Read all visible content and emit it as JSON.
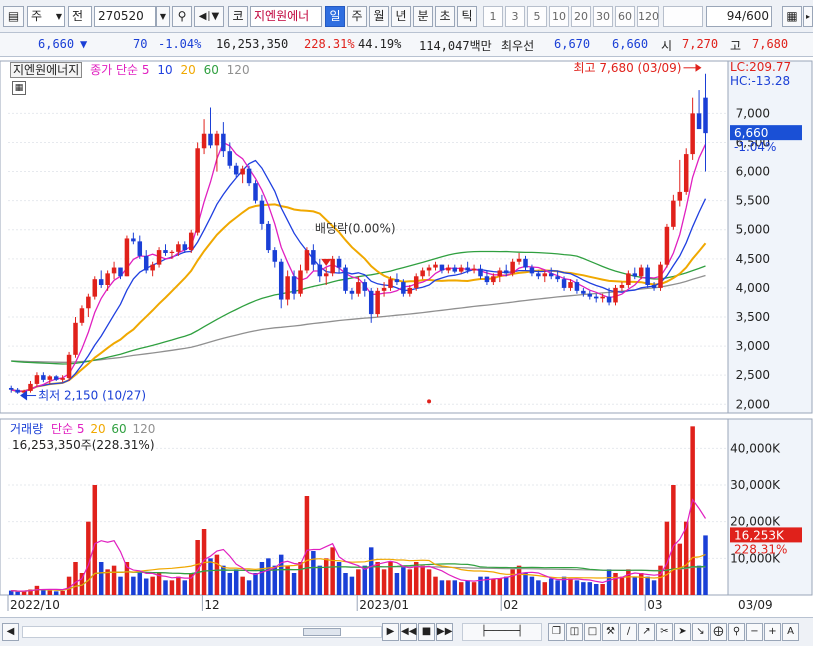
{
  "toolbar": {
    "market": "주",
    "type": "전",
    "code": "270520",
    "stock_prefix": "코",
    "stock_name": "지엔원에너",
    "periods": [
      "일",
      "주",
      "월",
      "년",
      "분",
      "초",
      "틱"
    ],
    "active_period": "일",
    "intervals": [
      "1",
      "3",
      "5",
      "10",
      "20",
      "30",
      "60",
      "120"
    ],
    "page": "94",
    "page_total": "/600"
  },
  "quote": {
    "price": "6,660",
    "change": "70",
    "change_pct": "-1.04%",
    "volume": "16,253,350",
    "volume_ratio": "228.31%",
    "turnover": "44.19%",
    "amount": "114,047백만",
    "best_ask_label": "최우선",
    "best_ask": "6,670",
    "best_bid": "6,660",
    "open_label": "시",
    "open": "7,270",
    "high_label": "고",
    "high": "7,680"
  },
  "price_panel": {
    "legend_name": "지엔원에너지",
    "legend_ma_label": "종가 단순 5",
    "legend_ma": [
      "10",
      "20",
      "60",
      "120"
    ],
    "lc_label": "LC:209.77",
    "hc_label": "HC:-13.28",
    "current_price": "6,660",
    "current_pct": "-1.04%",
    "high_annotation": "최고 7,680 (03/09)",
    "low_annotation": "최저 2,150 (10/27)",
    "event_annotation": "배당락(0.00%)"
  },
  "volume_panel": {
    "legend_name": "거래량",
    "legend_ma_label": "단순 5",
    "legend_ma": [
      "20",
      "60",
      "120"
    ],
    "volume_line": "16,253,350주(228.31%)",
    "current_volume": "16,253K",
    "current_ratio": "228.31%"
  },
  "chart_data": {
    "type": "candlestick",
    "x_ticks": [
      "2022/10",
      "12",
      "2023/01",
      "02",
      "03",
      "03/09"
    ],
    "price_axis": {
      "ticks": [
        "7,000",
        "6,500",
        "6,000",
        "5,500",
        "5,000",
        "4,500",
        "4,000",
        "3,500",
        "3,000",
        "2,500",
        "2,000"
      ],
      "range": [
        1850,
        7900
      ]
    },
    "volume_axis": {
      "ticks": [
        "40,000K",
        "30,000K",
        "20,000K",
        "10,000K"
      ],
      "range": [
        0,
        48000
      ]
    },
    "series_colors": {
      "ma5": "#e020c0",
      "ma10": "#2040e0",
      "ma20": "#f0a800",
      "ma60": "#30a040",
      "ma120": "#909090",
      "up": "#e0211b",
      "down": "#1a3fd6"
    },
    "candles": [
      [
        2280,
        2320,
        2200,
        2250,
        1200
      ],
      [
        2250,
        2280,
        2180,
        2200,
        900
      ],
      [
        2200,
        2250,
        2150,
        2230,
        1100
      ],
      [
        2230,
        2400,
        2200,
        2350,
        1500
      ],
      [
        2350,
        2550,
        2300,
        2500,
        2500
      ],
      [
        2500,
        2550,
        2380,
        2420,
        1500
      ],
      [
        2420,
        2500,
        2350,
        2480,
        1200
      ],
      [
        2480,
        2500,
        2400,
        2420,
        1000
      ],
      [
        2420,
        2500,
        2380,
        2450,
        1100
      ],
      [
        2450,
        2900,
        2400,
        2850,
        5000
      ],
      [
        2850,
        3500,
        2800,
        3400,
        9000
      ],
      [
        3400,
        3700,
        3350,
        3650,
        6000
      ],
      [
        3650,
        3900,
        3500,
        3850,
        20000
      ],
      [
        3850,
        4200,
        3800,
        4150,
        30000
      ],
      [
        4150,
        4300,
        4000,
        4050,
        9000
      ],
      [
        4050,
        4300,
        3950,
        4250,
        7000
      ],
      [
        4250,
        4450,
        4150,
        4350,
        8000
      ],
      [
        4350,
        4350,
        4150,
        4200,
        5000
      ],
      [
        4200,
        4900,
        4200,
        4850,
        9000
      ],
      [
        4850,
        4950,
        4750,
        4800,
        5000
      ],
      [
        4800,
        4900,
        4500,
        4550,
        6000
      ],
      [
        4550,
        4650,
        4250,
        4300,
        4500
      ],
      [
        4300,
        4450,
        4200,
        4400,
        5000
      ],
      [
        4400,
        4700,
        4350,
        4650,
        6000
      ],
      [
        4650,
        4750,
        4550,
        4600,
        4000
      ],
      [
        4600,
        4650,
        4500,
        4620,
        4000
      ],
      [
        4620,
        4800,
        4550,
        4750,
        5000
      ],
      [
        4750,
        4800,
        4600,
        4650,
        4000
      ],
      [
        4650,
        5000,
        4600,
        4950,
        6000
      ],
      [
        4950,
        6500,
        4900,
        6400,
        15000
      ],
      [
        6400,
        6900,
        6300,
        6650,
        18000
      ],
      [
        6650,
        7100,
        6400,
        6450,
        10000
      ],
      [
        6450,
        6700,
        6000,
        6650,
        11000
      ],
      [
        6650,
        6850,
        6250,
        6350,
        8000
      ],
      [
        6350,
        6500,
        6050,
        6100,
        6000
      ],
      [
        6100,
        6150,
        5900,
        5950,
        7000
      ],
      [
        5950,
        6100,
        5800,
        6050,
        5000
      ],
      [
        6050,
        6100,
        5750,
        5800,
        4000
      ],
      [
        5800,
        5850,
        5450,
        5500,
        6000
      ],
      [
        5500,
        5600,
        5000,
        5100,
        9000
      ],
      [
        5100,
        5150,
        4600,
        4650,
        10000
      ],
      [
        4650,
        4700,
        4350,
        4450,
        8000
      ],
      [
        4450,
        4500,
        3650,
        3800,
        11000
      ],
      [
        3800,
        4300,
        3700,
        4200,
        8000
      ],
      [
        4200,
        4300,
        3800,
        3900,
        6000
      ],
      [
        3900,
        4400,
        3850,
        4300,
        9000
      ],
      [
        4300,
        4700,
        4250,
        4650,
        27000
      ],
      [
        4650,
        4750,
        4300,
        4400,
        12000
      ],
      [
        4400,
        4500,
        4100,
        4200,
        8000
      ],
      [
        4200,
        4350,
        4050,
        4250,
        10000
      ],
      [
        4250,
        4550,
        4200,
        4500,
        13000
      ],
      [
        4500,
        4550,
        4250,
        4350,
        9000
      ],
      [
        4350,
        4400,
        3900,
        3950,
        6000
      ],
      [
        3950,
        4000,
        3800,
        3900,
        5000
      ],
      [
        3900,
        4200,
        3850,
        4100,
        7000
      ],
      [
        4100,
        4150,
        3850,
        3950,
        8000
      ],
      [
        3950,
        4000,
        3400,
        3550,
        13000
      ],
      [
        3550,
        4000,
        3500,
        3950,
        9000
      ],
      [
        3950,
        4100,
        3850,
        4000,
        7000
      ],
      [
        4000,
        4200,
        3950,
        4150,
        9000
      ],
      [
        4150,
        4250,
        4050,
        4100,
        6000
      ],
      [
        4100,
        4150,
        3850,
        3900,
        8000
      ],
      [
        3900,
        4050,
        3850,
        4000,
        7000
      ],
      [
        4000,
        4250,
        3950,
        4200,
        9000
      ],
      [
        4200,
        4350,
        4150,
        4300,
        8000
      ],
      [
        4300,
        4400,
        4200,
        4350,
        7000
      ],
      [
        4350,
        4450,
        4300,
        4400,
        5000
      ],
      [
        4400,
        4400,
        4250,
        4300,
        4000
      ],
      [
        4300,
        4400,
        4250,
        4350,
        4000
      ],
      [
        4350,
        4400,
        4250,
        4280,
        4000
      ],
      [
        4280,
        4400,
        4250,
        4350,
        3500
      ],
      [
        4350,
        4450,
        4250,
        4300,
        4000
      ],
      [
        4300,
        4400,
        4250,
        4330,
        3500
      ],
      [
        4330,
        4400,
        4150,
        4200,
        5000
      ],
      [
        4200,
        4300,
        4050,
        4100,
        5000
      ],
      [
        4100,
        4250,
        4050,
        4200,
        4500
      ],
      [
        4200,
        4350,
        4100,
        4300,
        4500
      ],
      [
        4300,
        4400,
        4200,
        4250,
        5000
      ],
      [
        4250,
        4500,
        4200,
        4450,
        7000
      ],
      [
        4450,
        4600,
        4400,
        4500,
        8000
      ],
      [
        4500,
        4550,
        4300,
        4350,
        6000
      ],
      [
        4350,
        4400,
        4200,
        4250,
        5000
      ],
      [
        4250,
        4300,
        4150,
        4200,
        4000
      ],
      [
        4200,
        4300,
        4100,
        4250,
        3500
      ],
      [
        4250,
        4350,
        4150,
        4200,
        4500
      ],
      [
        4200,
        4300,
        4100,
        4150,
        4000
      ],
      [
        4150,
        4200,
        3950,
        4000,
        5000
      ],
      [
        4000,
        4150,
        3950,
        4100,
        4500
      ],
      [
        4100,
        4150,
        3900,
        3950,
        4000
      ],
      [
        3950,
        4000,
        3850,
        3900,
        3500
      ],
      [
        3900,
        3950,
        3800,
        3850,
        3500
      ],
      [
        3850,
        3900,
        3750,
        3820,
        3000
      ],
      [
        3820,
        3900,
        3750,
        3850,
        3000
      ],
      [
        3850,
        4000,
        3700,
        3750,
        7000
      ],
      [
        3750,
        4050,
        3700,
        4000,
        6000
      ],
      [
        4000,
        4100,
        3950,
        4050,
        5000
      ],
      [
        4050,
        4300,
        4000,
        4250,
        7000
      ],
      [
        4250,
        4350,
        4150,
        4200,
        5000
      ],
      [
        4200,
        4400,
        4150,
        4350,
        6000
      ],
      [
        4350,
        4400,
        4000,
        4050,
        5000
      ],
      [
        4050,
        4100,
        3950,
        4000,
        4000
      ],
      [
        4000,
        4450,
        3950,
        4400,
        8000
      ],
      [
        4400,
        5100,
        4350,
        5050,
        20000
      ],
      [
        5050,
        5600,
        5000,
        5500,
        30000
      ],
      [
        5500,
        6200,
        5400,
        5650,
        14000
      ],
      [
        5650,
        6400,
        5600,
        6300,
        20000
      ],
      [
        6300,
        7270,
        6200,
        7000,
        46000
      ],
      [
        7000,
        7400,
        6800,
        6730,
        8000
      ],
      [
        7270,
        7680,
        6000,
        6660,
        16253
      ]
    ]
  }
}
